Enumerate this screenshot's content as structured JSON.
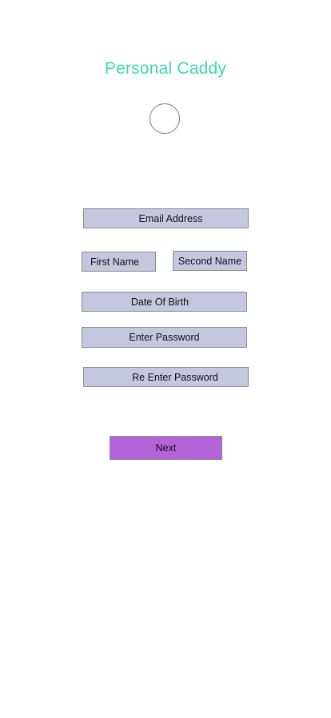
{
  "app": {
    "title": "Personal Caddy"
  },
  "form": {
    "email_label": "Email Address",
    "first_name_label": "First Name",
    "second_name_label": "Second Name",
    "dob_label": "Date Of Birth",
    "password_label": "Enter Password",
    "reenter_password_label": "Re Enter Password"
  },
  "actions": {
    "next_label": "Next"
  },
  "colors": {
    "title": "#3ed7b4",
    "field_background": "#c3c8e0",
    "next_button": "#b563d8"
  }
}
